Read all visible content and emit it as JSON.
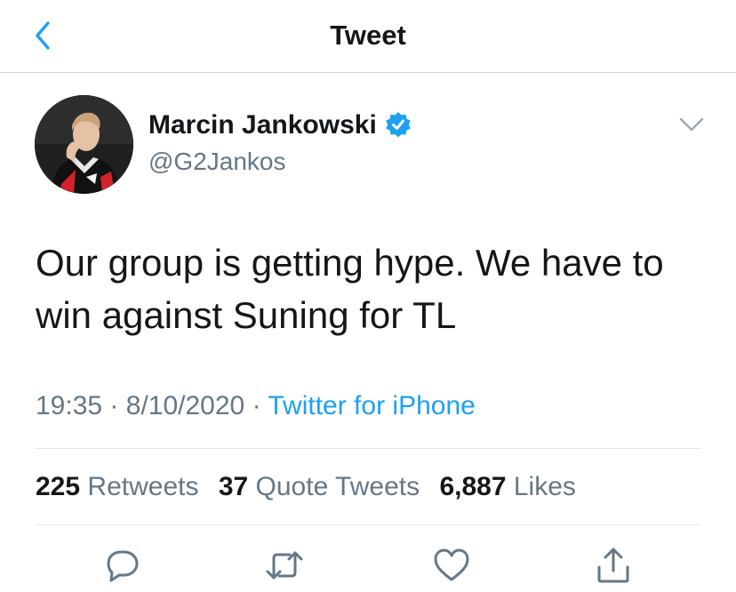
{
  "header": {
    "title": "Tweet",
    "back_icon": "chevron-left-icon",
    "accent": "#1da1f2"
  },
  "author": {
    "name": "Marcin Jankowski",
    "handle": "@G2Jankos",
    "verified": true,
    "verified_color": "#1da1f2"
  },
  "tweet": {
    "text_line1": "Our group is getting hype. We have to",
    "text_line2": "win against Suning for TL",
    "time": "19:35",
    "date": "8/10/2020",
    "source": "Twitter for iPhone",
    "separator": "·"
  },
  "stats": {
    "retweets": {
      "count": "225",
      "label": "Retweets"
    },
    "quotes": {
      "count": "37",
      "label": "Quote Tweets"
    },
    "likes": {
      "count": "6,887",
      "label": "Likes"
    }
  },
  "actions": [
    "reply-icon",
    "retweet-icon",
    "like-icon",
    "share-icon"
  ],
  "colors": {
    "text": "#14171a",
    "secondary": "#657786",
    "link": "#1da1f2",
    "divider": "#e1e8ed"
  }
}
